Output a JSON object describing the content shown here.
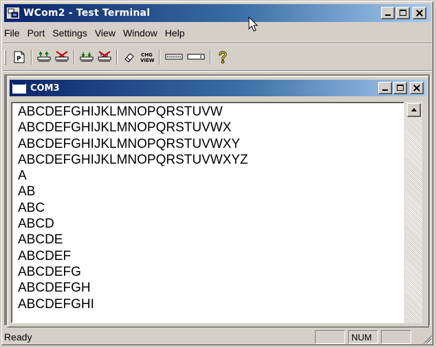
{
  "window": {
    "title": "WCom2 - Test Terminal"
  },
  "menu": [
    "File",
    "Port",
    "Settings",
    "View",
    "Window",
    "Help"
  ],
  "toolbar": {
    "icons": [
      "properties-icon",
      "connect-port-icon",
      "disconnect-port-icon",
      "connect-all-icon",
      "disconnect-all-icon",
      "clear-icon",
      "change-view-icon",
      "buffer-icon",
      "input-icon",
      "help-icon"
    ],
    "chg_view_label_top": "CHG",
    "chg_view_label_bottom": "VIEW"
  },
  "child_window": {
    "title": "COM3"
  },
  "terminal": {
    "lines": [
      "ABCDEFGHIJKLMNOPQRSTUVW",
      "ABCDEFGHIJKLMNOPQRSTUVWX",
      "ABCDEFGHIJKLMNOPQRSTUVWXY",
      "ABCDEFGHIJKLMNOPQRSTUVWXYZ",
      "A",
      "AB",
      "ABC",
      "ABCD",
      "ABCDE",
      "ABCDEF",
      "ABCDEFG",
      "ABCDEFGH",
      "ABCDEFGHI"
    ]
  },
  "status": {
    "text": "Ready",
    "panes": [
      "",
      "NUM",
      ""
    ]
  },
  "colors": {
    "titlebar_start": "#0a246a",
    "titlebar_end": "#a6caf0",
    "face": "#d4d0c8"
  }
}
